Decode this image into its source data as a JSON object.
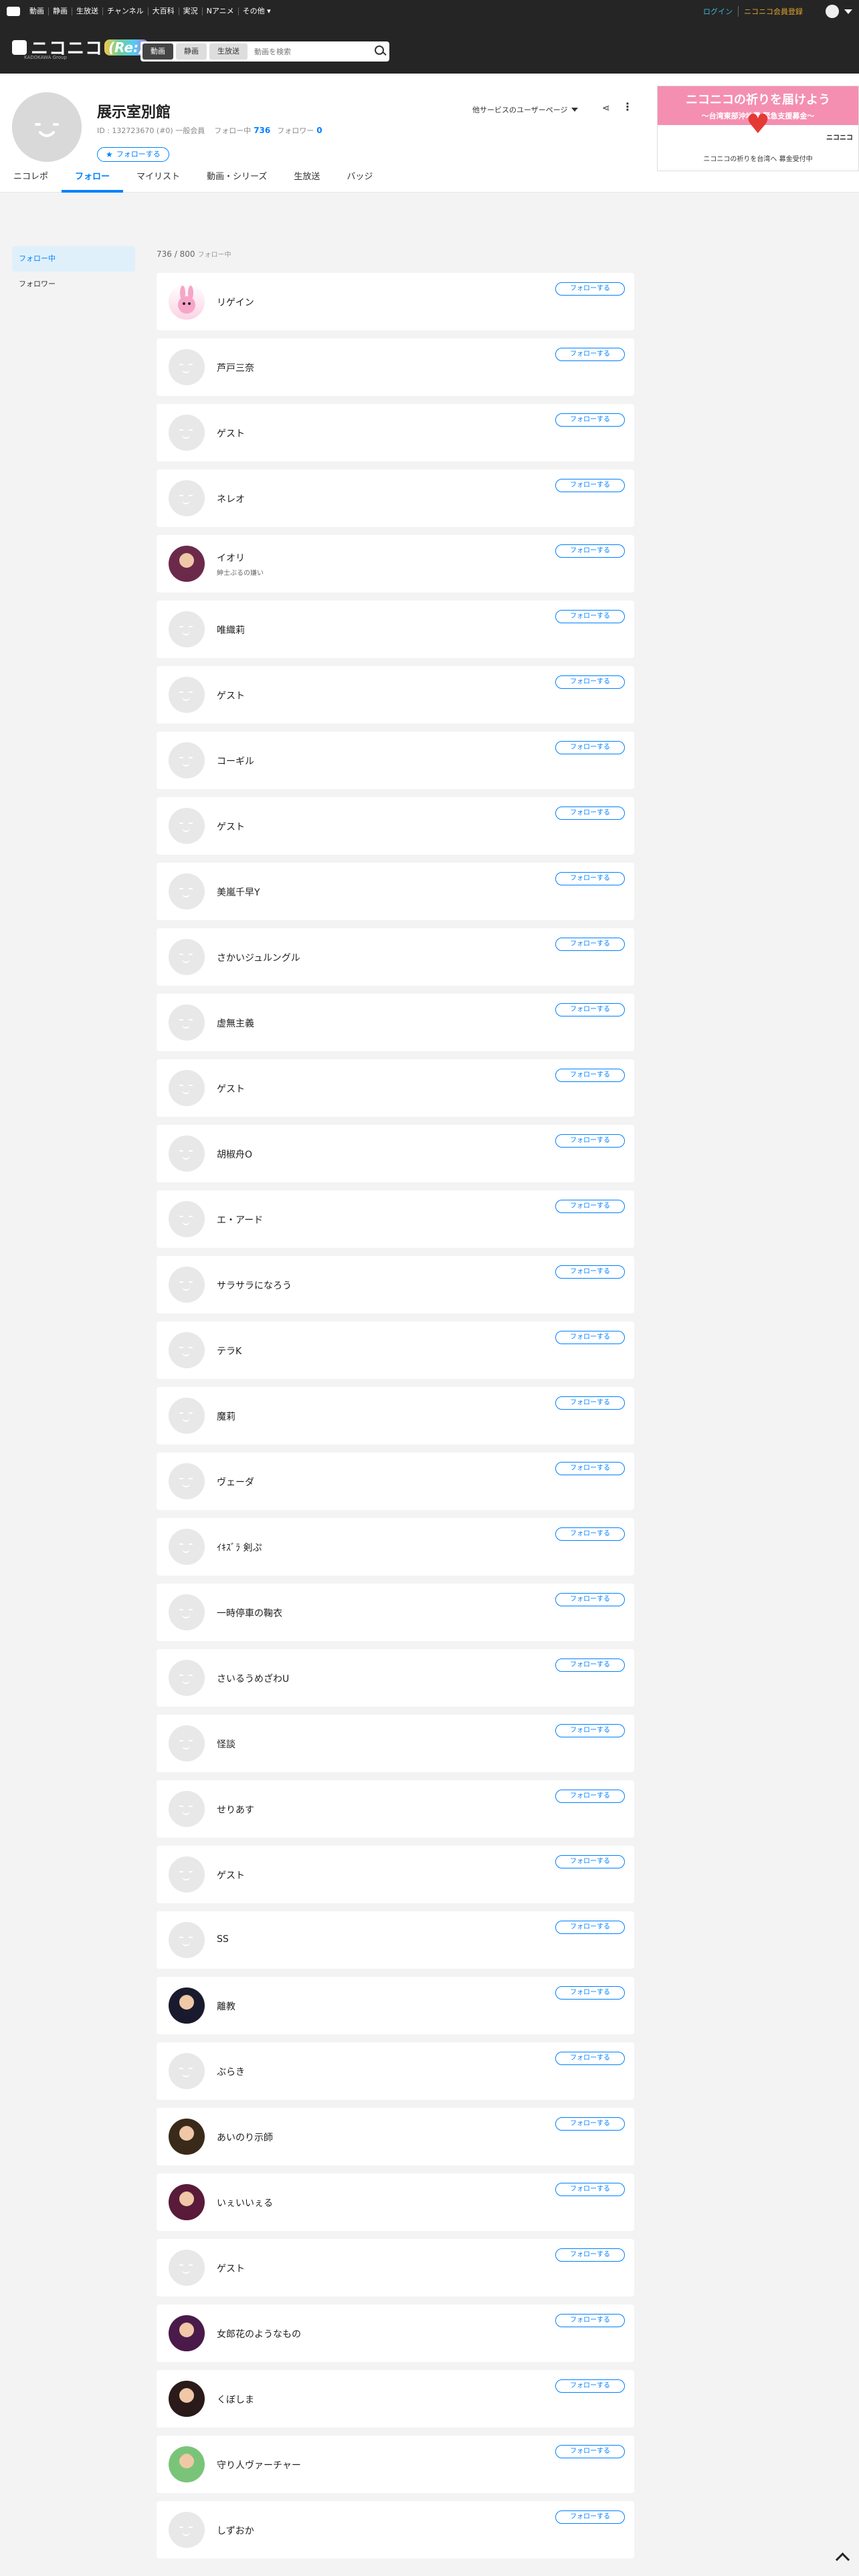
{
  "topbar": {
    "nav": [
      "動画",
      "静画",
      "生放送",
      "チャンネル",
      "大百科",
      "実況",
      "Nアニメ",
      "その他 ▾"
    ],
    "login": "ログイン",
    "register": "ニコニコ会員登録"
  },
  "header": {
    "logo": "ニコニコ",
    "logo_re": "(Re:)",
    "logo_sub": "KADOKAWA Group",
    "search_tabs": [
      "動画",
      "静画",
      "生放送"
    ],
    "search_placeholder": "動画を検索"
  },
  "profile": {
    "name": "展示室別館",
    "id_text": "ID : 132723670 (#0) 一般会員",
    "following_label": "フォロー中",
    "following_count": "736",
    "followers_label": "フォロワー",
    "followers_count": "0",
    "follow_button": "フォローする",
    "other_services": "他サービスのユーザーページ",
    "tabs": [
      "ニコレポ",
      "フォロー",
      "マイリスト",
      "動画・シリーズ",
      "生放送",
      "バッジ"
    ],
    "active_tab": "フォロー"
  },
  "ad": {
    "title": "ニコニコの祈りを届けよう",
    "subtitle": "〜台湾東部沖地震 緊急支援募金〜",
    "brand": "ニコニコ",
    "caption": "ニコニコの祈りを台湾へ 募金受付中"
  },
  "sidebar": {
    "items": [
      "フォロー中",
      "フォロワー"
    ]
  },
  "follow_count": {
    "value": "736 / 800",
    "label": "フォロー中"
  },
  "users": [
    {
      "name": "リゲイン",
      "desc": "",
      "avatar": "bunny",
      "color": "#f6a6c8"
    },
    {
      "name": "芦戸三奈",
      "desc": "",
      "avatar": "default",
      "color": "#e8e8e8"
    },
    {
      "name": "ゲスト",
      "desc": "",
      "avatar": "default",
      "color": "#e8e8e8"
    },
    {
      "name": "ネレオ",
      "desc": "",
      "avatar": "default",
      "color": "#e8e8e8"
    },
    {
      "name": "イオリ",
      "desc": "紳士ぶるの嫌い",
      "avatar": "photo",
      "color": "#6b2a4a"
    },
    {
      "name": "唯織莉",
      "desc": "",
      "avatar": "default",
      "color": "#e8e8e8"
    },
    {
      "name": "ゲスト",
      "desc": "",
      "avatar": "default",
      "color": "#e8e8e8"
    },
    {
      "name": "コーギル",
      "desc": "",
      "avatar": "default",
      "color": "#e8e8e8"
    },
    {
      "name": "ゲスト",
      "desc": "",
      "avatar": "default",
      "color": "#e8e8e8"
    },
    {
      "name": "美嵐千早Y",
      "desc": "",
      "avatar": "default",
      "color": "#e8e8e8"
    },
    {
      "name": "さかいジュルングル",
      "desc": "",
      "avatar": "default",
      "color": "#e8e8e8"
    },
    {
      "name": "虚無主義",
      "desc": "",
      "avatar": "default",
      "color": "#e8e8e8"
    },
    {
      "name": "ゲスト",
      "desc": "",
      "avatar": "default",
      "color": "#e8e8e8"
    },
    {
      "name": "胡椒舟O",
      "desc": "",
      "avatar": "default",
      "color": "#e8e8e8"
    },
    {
      "name": "エ・アード",
      "desc": "",
      "avatar": "default",
      "color": "#e8e8e8"
    },
    {
      "name": "サラサラになろう",
      "desc": "",
      "avatar": "default",
      "color": "#e8e8e8"
    },
    {
      "name": "テラK",
      "desc": "",
      "avatar": "default",
      "color": "#e8e8e8"
    },
    {
      "name": "魔莉",
      "desc": "",
      "avatar": "default",
      "color": "#e8e8e8"
    },
    {
      "name": "ヴェーダ",
      "desc": "",
      "avatar": "default",
      "color": "#e8e8e8"
    },
    {
      "name": "ｲｷｽﾞﾗ 剣ぷ",
      "desc": "",
      "avatar": "default",
      "color": "#e8e8e8"
    },
    {
      "name": "一時停車の鞠衣",
      "desc": "",
      "avatar": "default",
      "color": "#e8e8e8"
    },
    {
      "name": "さいるうめざわU",
      "desc": "",
      "avatar": "default",
      "color": "#e8e8e8"
    },
    {
      "name": "怪談",
      "desc": "",
      "avatar": "default",
      "color": "#e8e8e8"
    },
    {
      "name": "せりあす",
      "desc": "",
      "avatar": "default",
      "color": "#e8e8e8"
    },
    {
      "name": "ゲスト",
      "desc": "",
      "avatar": "default",
      "color": "#e8e8e8"
    },
    {
      "name": "SS",
      "desc": "",
      "avatar": "default",
      "color": "#e8e8e8"
    },
    {
      "name": "離教",
      "desc": "",
      "avatar": "photo",
      "color": "#1a1a2e"
    },
    {
      "name": "ぶらき",
      "desc": "",
      "avatar": "default",
      "color": "#e8e8e8"
    },
    {
      "name": "あいのり示師",
      "desc": "",
      "avatar": "photo",
      "color": "#3a2a1a"
    },
    {
      "name": "いぇいいぇる",
      "desc": "",
      "avatar": "photo",
      "color": "#5a1a3a"
    },
    {
      "name": "ゲスト",
      "desc": "",
      "avatar": "default",
      "color": "#e8e8e8"
    },
    {
      "name": "女郎花のようなもの",
      "desc": "",
      "avatar": "photo",
      "color": "#4a1a4a"
    },
    {
      "name": "くぼしま",
      "desc": "",
      "avatar": "photo",
      "color": "#2a1a1a"
    },
    {
      "name": "守り人ヴァーチャー",
      "desc": "",
      "avatar": "photo",
      "color": "#7ac47a"
    },
    {
      "name": "しずおか",
      "desc": "",
      "avatar": "default",
      "color": "#e8e8e8"
    }
  ],
  "follow_button_label": "フォローする"
}
